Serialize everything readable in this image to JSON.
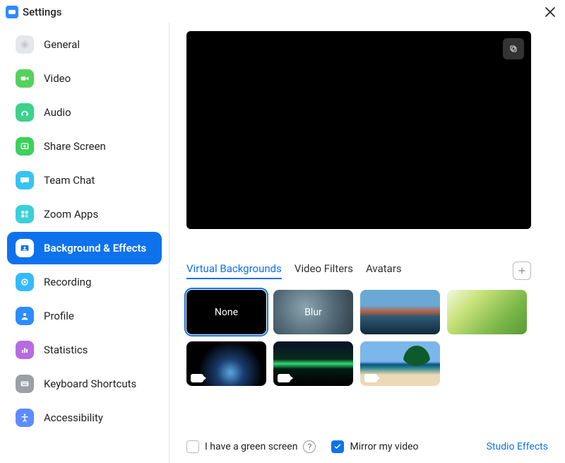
{
  "header": {
    "title": "Settings"
  },
  "sidebar": {
    "items": [
      {
        "label": "General",
        "icon": "gear-icon",
        "iconBg": "#e5e7eb",
        "iconFg": "#c0c4ca"
      },
      {
        "label": "Video",
        "icon": "video-icon",
        "iconBg": "#55d15b",
        "iconFg": "#ffffff"
      },
      {
        "label": "Audio",
        "icon": "audio-icon",
        "iconBg": "#3dd18b",
        "iconFg": "#ffffff"
      },
      {
        "label": "Share Screen",
        "icon": "share-screen-icon",
        "iconBg": "#3dd15b",
        "iconFg": "#ffffff"
      },
      {
        "label": "Team Chat",
        "icon": "chat-icon",
        "iconBg": "#37c4f0",
        "iconFg": "#ffffff"
      },
      {
        "label": "Zoom Apps",
        "icon": "apps-icon",
        "iconBg": "#3ccfda",
        "iconFg": "#ffffff"
      },
      {
        "label": "Background & Effects",
        "icon": "background-icon",
        "iconBg": "#ffffff",
        "iconFg": "#0E72ED",
        "active": true
      },
      {
        "label": "Recording",
        "icon": "recording-icon",
        "iconBg": "#35b9ff",
        "iconFg": "#ffffff"
      },
      {
        "label": "Profile",
        "icon": "profile-icon",
        "iconBg": "#2D8CFF",
        "iconFg": "#ffffff"
      },
      {
        "label": "Statistics",
        "icon": "statistics-icon",
        "iconBg": "#b76be0",
        "iconFg": "#ffffff"
      },
      {
        "label": "Keyboard Shortcuts",
        "icon": "keyboard-icon",
        "iconBg": "#9aa0a6",
        "iconFg": "#ffffff"
      },
      {
        "label": "Accessibility",
        "icon": "accessibility-icon",
        "iconBg": "#5e8cff",
        "iconFg": "#ffffff"
      }
    ]
  },
  "tabs": {
    "items": [
      {
        "label": "Virtual Backgrounds",
        "active": true
      },
      {
        "label": "Video Filters"
      },
      {
        "label": "Avatars"
      }
    ]
  },
  "backgrounds": {
    "tiles": [
      {
        "label": "None",
        "kind": "none",
        "selected": true
      },
      {
        "label": "Blur",
        "kind": "blur"
      },
      {
        "label": "",
        "kind": "bridge"
      },
      {
        "label": "",
        "kind": "grass"
      },
      {
        "label": "",
        "kind": "earth",
        "videoBadge": true
      },
      {
        "label": "",
        "kind": "aurora",
        "videoBadge": true
      },
      {
        "label": "",
        "kind": "beach",
        "videoBadge": true
      }
    ]
  },
  "bottom": {
    "greenScreen": {
      "label": "I have a green screen",
      "checked": false
    },
    "mirror": {
      "label": "Mirror my video",
      "checked": true
    },
    "studioEffects": "Studio Effects"
  }
}
